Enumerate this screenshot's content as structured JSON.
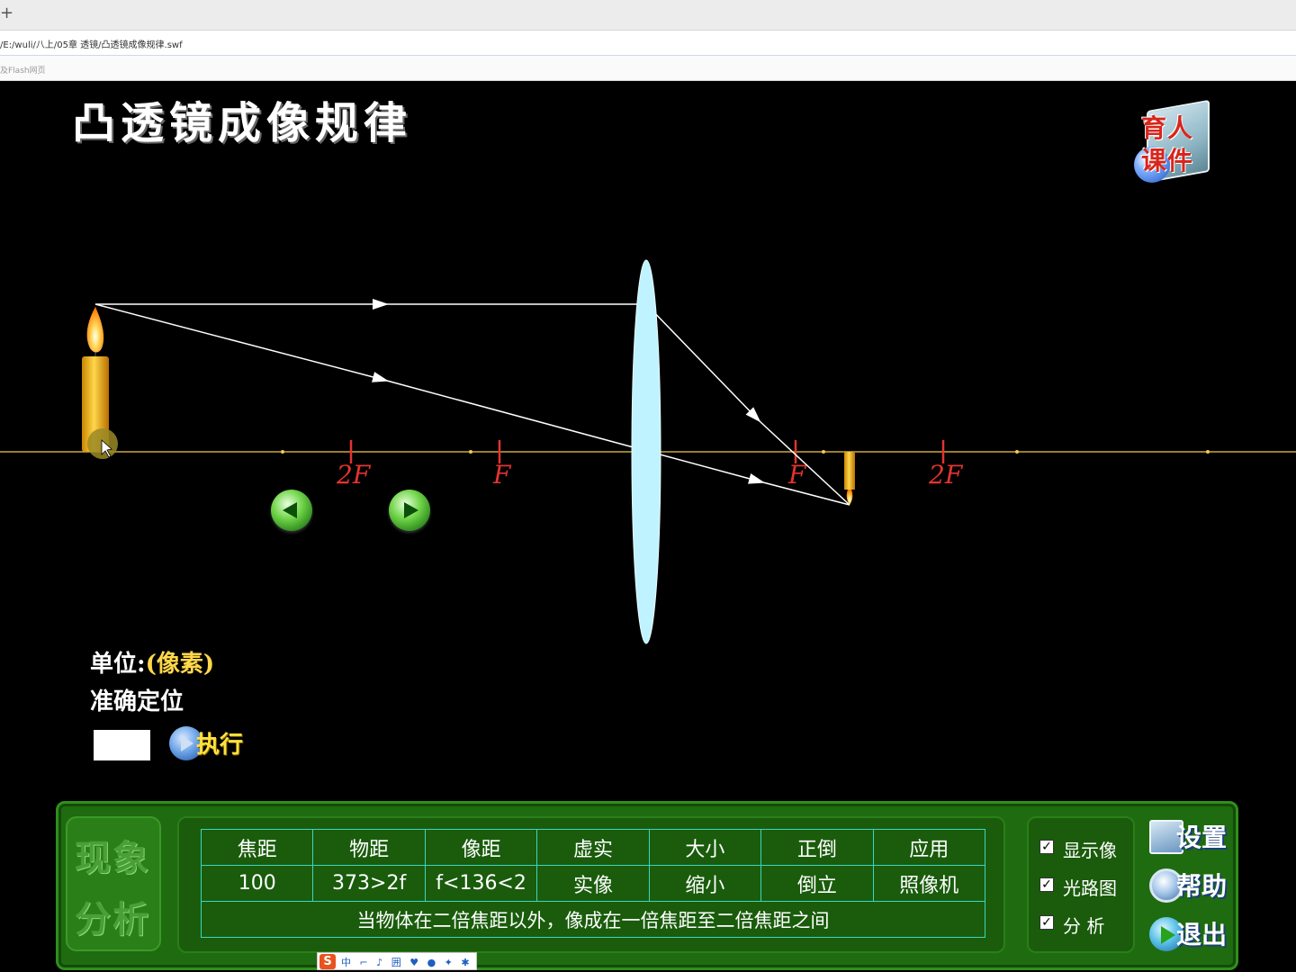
{
  "browser": {
    "new_tab_glyph": "+",
    "url": "/E:/wuli/八上/05章 透镜/凸透镜成像规律.swf",
    "bookmark": "及Flash网页"
  },
  "stage": {
    "title": "凸透镜成像规律",
    "logo": {
      "line1": "育人",
      "line2": "课件"
    },
    "axis_labels": {
      "left_2f": "2F",
      "left_f": "F",
      "right_f": "F",
      "right_2f": "2F"
    },
    "unit_label": "单位:",
    "unit_value": "(像素)",
    "precise_label": "准确定位",
    "position_input_value": "",
    "exec_label": "执行",
    "prev_icon": "left-arrow-icon",
    "next_icon": "right-arrow-icon",
    "colors": {
      "axis": "#f2c94c",
      "lens": "#bff3ff",
      "focal_mark": "#e3342f",
      "rays": "#ffffff"
    }
  },
  "panel": {
    "phenomenon_label": [
      "现象",
      "分析"
    ],
    "headers": [
      "焦距",
      "物距",
      "像距",
      "虚实",
      "大小",
      "正倒",
      "应用"
    ],
    "values": [
      "100",
      "373>2f",
      "f<136<2",
      "实像",
      "缩小",
      "倒立",
      "照像机"
    ],
    "note": "当物体在二倍焦距以外，像成在一倍焦距至二倍焦距之间",
    "options": [
      {
        "label": "显示像",
        "checked": true
      },
      {
        "label": "光路图",
        "checked": true
      },
      {
        "label": "分 析",
        "checked": true
      }
    ],
    "buttons": {
      "settings": "设置",
      "help": "帮助",
      "exit": "退出"
    }
  },
  "ime": {
    "logo": "S",
    "items": "中 ⌐ ♪ 囲 ♥ ● ✦ ✱"
  }
}
